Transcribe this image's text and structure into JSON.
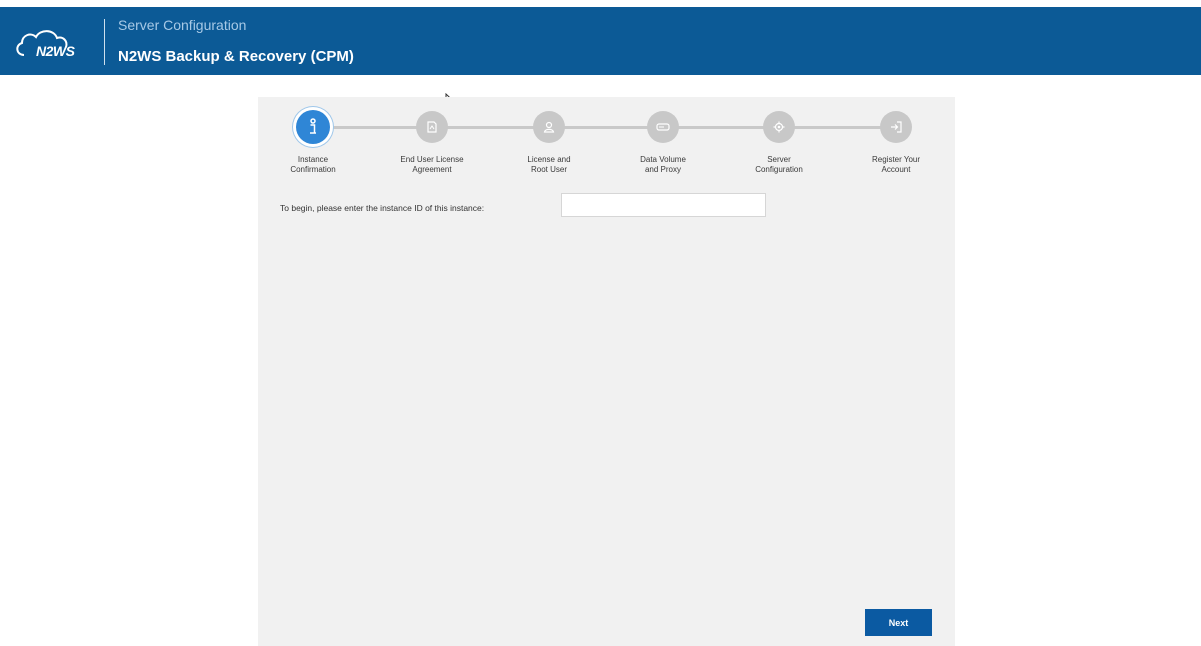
{
  "header": {
    "logo_text": "N2WS",
    "subtitle": "Server Configuration",
    "title": "N2WS Backup & Recovery (CPM)"
  },
  "wizard": {
    "steps": [
      {
        "label": "Instance\nConfirmation",
        "icon": "info-icon",
        "active": true
      },
      {
        "label": "End User License\nAgreement",
        "icon": "document-icon",
        "active": false
      },
      {
        "label": "License and\nRoot User",
        "icon": "user-icon",
        "active": false
      },
      {
        "label": "Data Volume\nand Proxy",
        "icon": "drive-icon",
        "active": false
      },
      {
        "label": "Server\nConfiguration",
        "icon": "gear-icon",
        "active": false
      },
      {
        "label": "Register Your\nAccount",
        "icon": "sign-in-icon",
        "active": false
      }
    ],
    "prompt": "To begin, please enter the instance ID of this instance:",
    "instance_input": {
      "value": "",
      "placeholder": ""
    },
    "next_label": "Next"
  },
  "colors": {
    "header_bg": "#0c5a96",
    "active_step": "#2f86d6",
    "inactive_step": "#c8c8c8",
    "button": "#0b5aa2"
  }
}
